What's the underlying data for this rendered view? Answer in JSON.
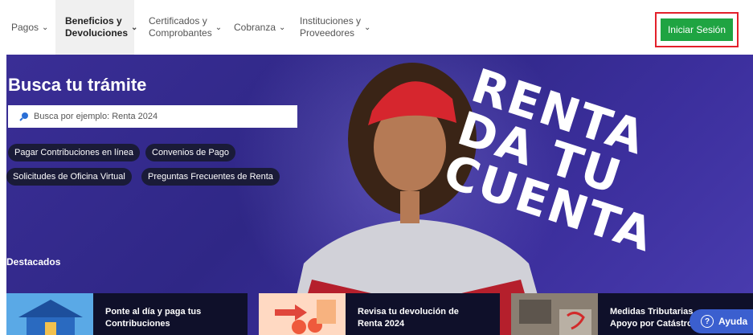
{
  "nav": {
    "items": [
      {
        "label_1": "Pagos",
        "label_2": ""
      },
      {
        "label_1": "Beneficios y",
        "label_2": "Devoluciones"
      },
      {
        "label_1": "Certificados y",
        "label_2": "Comprobantes"
      },
      {
        "label_1": "Cobranza",
        "label_2": ""
      },
      {
        "label_1": "Instituciones y",
        "label_2": "Proveedores"
      }
    ],
    "login_label": "Iniciar Sesión"
  },
  "hero": {
    "search_title": "Busca tu trámite",
    "search_placeholder": "Busca por ejemplo: Renta 2024",
    "chips": [
      "Pagar Contribuciones en línea",
      "Convenios de Pago",
      "Solicitudes de Oficina Virtual",
      "Preguntas Frecuentes de Renta"
    ],
    "promo_lines": [
      "RENTA",
      "DA TU",
      "CUENTA"
    ]
  },
  "featured": {
    "heading": "Destacados",
    "cards": [
      {
        "line_1": "Ponte al día y paga tus",
        "line_2": "Contribuciones"
      },
      {
        "line_1": "Revisa tu devolución de",
        "line_2": "Renta 2024"
      },
      {
        "line_1": "Medidas Tributarias",
        "line_2": "Apoyo por Catástro"
      }
    ]
  },
  "help_label": "Ayuda",
  "colors": {
    "accent_green": "#1fa442",
    "highlight_red": "#e3202b",
    "hero_purple": "#3a2e96",
    "help_blue": "#3b5fcf"
  }
}
